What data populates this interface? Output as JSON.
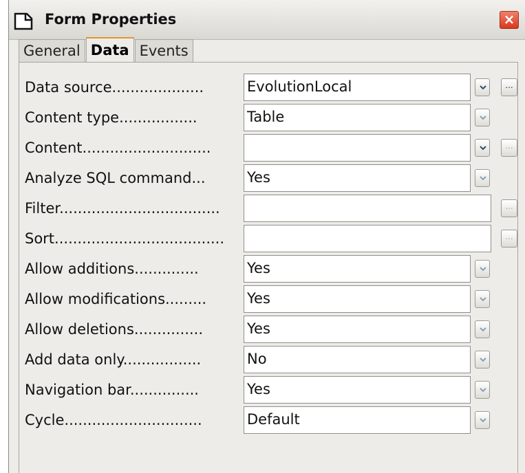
{
  "window": {
    "title": "Form Properties",
    "close_label": "×"
  },
  "tabs": [
    {
      "label": "General",
      "active": false
    },
    {
      "label": "Data",
      "active": true
    },
    {
      "label": "Events",
      "active": false
    }
  ],
  "fields": {
    "data_source": {
      "label": "Data source....................",
      "value": "EvolutionLocal"
    },
    "content_type": {
      "label": "Content type.................",
      "value": "Table"
    },
    "content": {
      "label": "Content............................",
      "value": ""
    },
    "analyze_sql": {
      "label": "Analyze SQL command...",
      "value": "Yes"
    },
    "filter": {
      "label": "Filter...................................",
      "value": ""
    },
    "sort": {
      "label": "Sort.....................................",
      "value": ""
    },
    "allow_additions": {
      "label": "Allow additions..............",
      "value": "Yes"
    },
    "allow_modifications": {
      "label": "Allow modifications.........",
      "value": "Yes"
    },
    "allow_deletions": {
      "label": "Allow deletions...............",
      "value": "Yes"
    },
    "add_data_only": {
      "label": "Add data only.................",
      "value": "No"
    },
    "navigation_bar": {
      "label": "Navigation bar...............",
      "value": "Yes"
    },
    "cycle": {
      "label": "Cycle..............................",
      "value": "Default"
    }
  },
  "browse_label": "...",
  "colors": {
    "accent_tab": "#e0962a",
    "close_button": "#d9381e"
  }
}
